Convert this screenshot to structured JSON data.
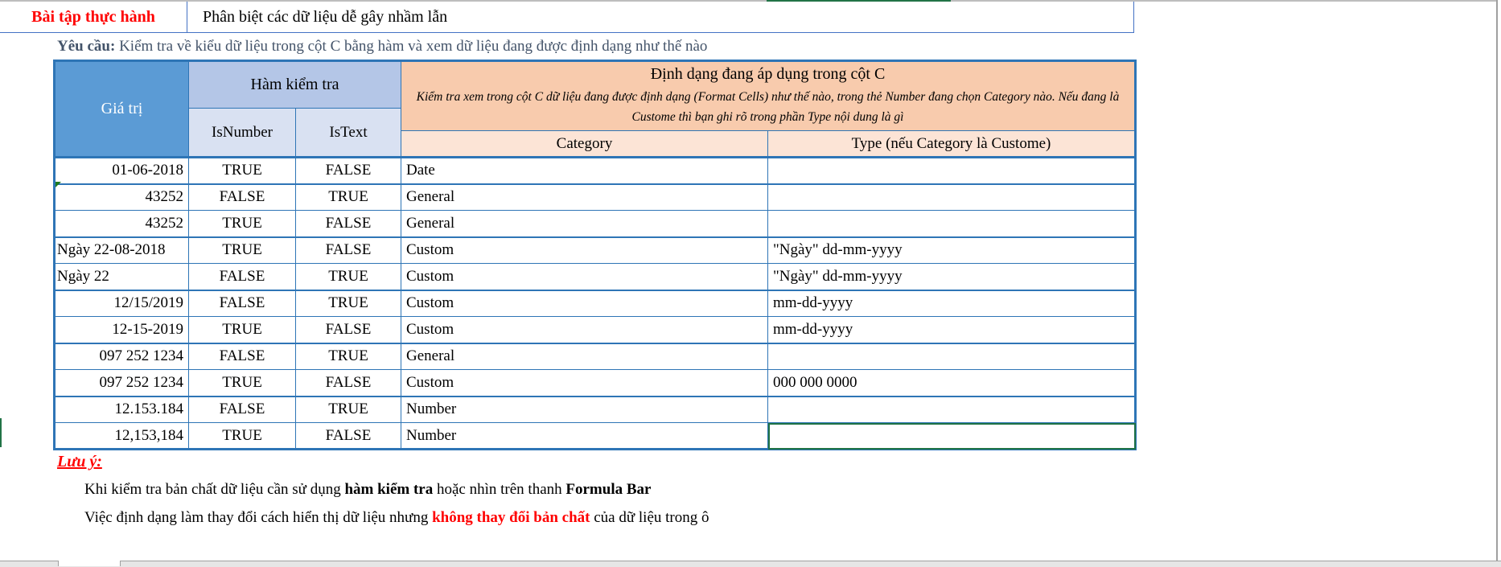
{
  "title": {
    "label": "Bài tập thực hành",
    "text": "Phân biệt các dữ liệu dễ gây nhầm lẫn"
  },
  "requirement": {
    "label": "Yêu cầu:",
    "text": " Kiểm tra về kiểu dữ liệu trong cột C bằng hàm và xem dữ liệu đang được định dạng như thế nào"
  },
  "table": {
    "headers": {
      "value": "Giá trị",
      "check_functions": "Hàm kiểm tra",
      "isnumber": "IsNumber",
      "istext": "IsText",
      "format_title": "Định dạng đang áp dụng trong cột C",
      "format_desc": "Kiểm tra xem trong cột C dữ liệu đang được định dạng (Format Cells) như thế nào, trong thẻ Number đang chọn Category nào. Nếu đang là Custome thì bạn ghi rõ trong phần Type nội dung là gì",
      "category": "Category",
      "type": "Type (nếu Category là Custome)"
    },
    "rows": [
      {
        "value": "01-06-2018",
        "isnumber": "TRUE",
        "istext": "FALSE",
        "category": "Date",
        "type": ""
      },
      {
        "value": "43252",
        "isnumber": "FALSE",
        "istext": "TRUE",
        "category": "General",
        "type": ""
      },
      {
        "value": "43252",
        "isnumber": "TRUE",
        "istext": "FALSE",
        "category": "General",
        "type": ""
      },
      {
        "value": "Ngày 22-08-2018",
        "isnumber": "TRUE",
        "istext": "FALSE",
        "category": "Custom",
        "type": "\"Ngày\" dd-mm-yyyy"
      },
      {
        "value": "Ngày 22",
        "isnumber": "FALSE",
        "istext": "TRUE",
        "category": "Custom",
        "type": "\"Ngày\" dd-mm-yyyy"
      },
      {
        "value": "12/15/2019",
        "isnumber": "FALSE",
        "istext": "TRUE",
        "category": "Custom",
        "type": "mm-dd-yyyy"
      },
      {
        "value": "12-15-2019",
        "isnumber": "TRUE",
        "istext": "FALSE",
        "category": "Custom",
        "type": "mm-dd-yyyy"
      },
      {
        "value": "097 252 1234",
        "isnumber": "FALSE",
        "istext": "TRUE",
        "category": "General",
        "type": ""
      },
      {
        "value": "097 252 1234",
        "isnumber": "TRUE",
        "istext": "FALSE",
        "category": "Custom",
        "type": "000 000 0000"
      },
      {
        "value": "12.153.184",
        "isnumber": "FALSE",
        "istext": "TRUE",
        "category": "Number",
        "type": ""
      },
      {
        "value": "12,153,184",
        "isnumber": "TRUE",
        "istext": "FALSE",
        "category": "Number",
        "type": ""
      }
    ]
  },
  "notes": {
    "heading": "Lưu ý:",
    "line1": {
      "a": "Khi kiểm tra bản chất dữ liệu cần sử dụng ",
      "b": "hàm kiểm tra",
      "c": " hoặc nhìn trên thanh ",
      "d": "Formula Bar"
    },
    "line2": {
      "a": "Việc định dạng làm thay đổi cách hiển thị dữ liệu nhưng ",
      "b": "không thay đổi bản chất",
      "c": " của dữ liệu trong ô"
    }
  },
  "colors": {
    "accent_red": "#ff0000",
    "header_blue": "#5b9bd5",
    "header_orange": "#f8cbad",
    "selection_green": "#217346"
  }
}
